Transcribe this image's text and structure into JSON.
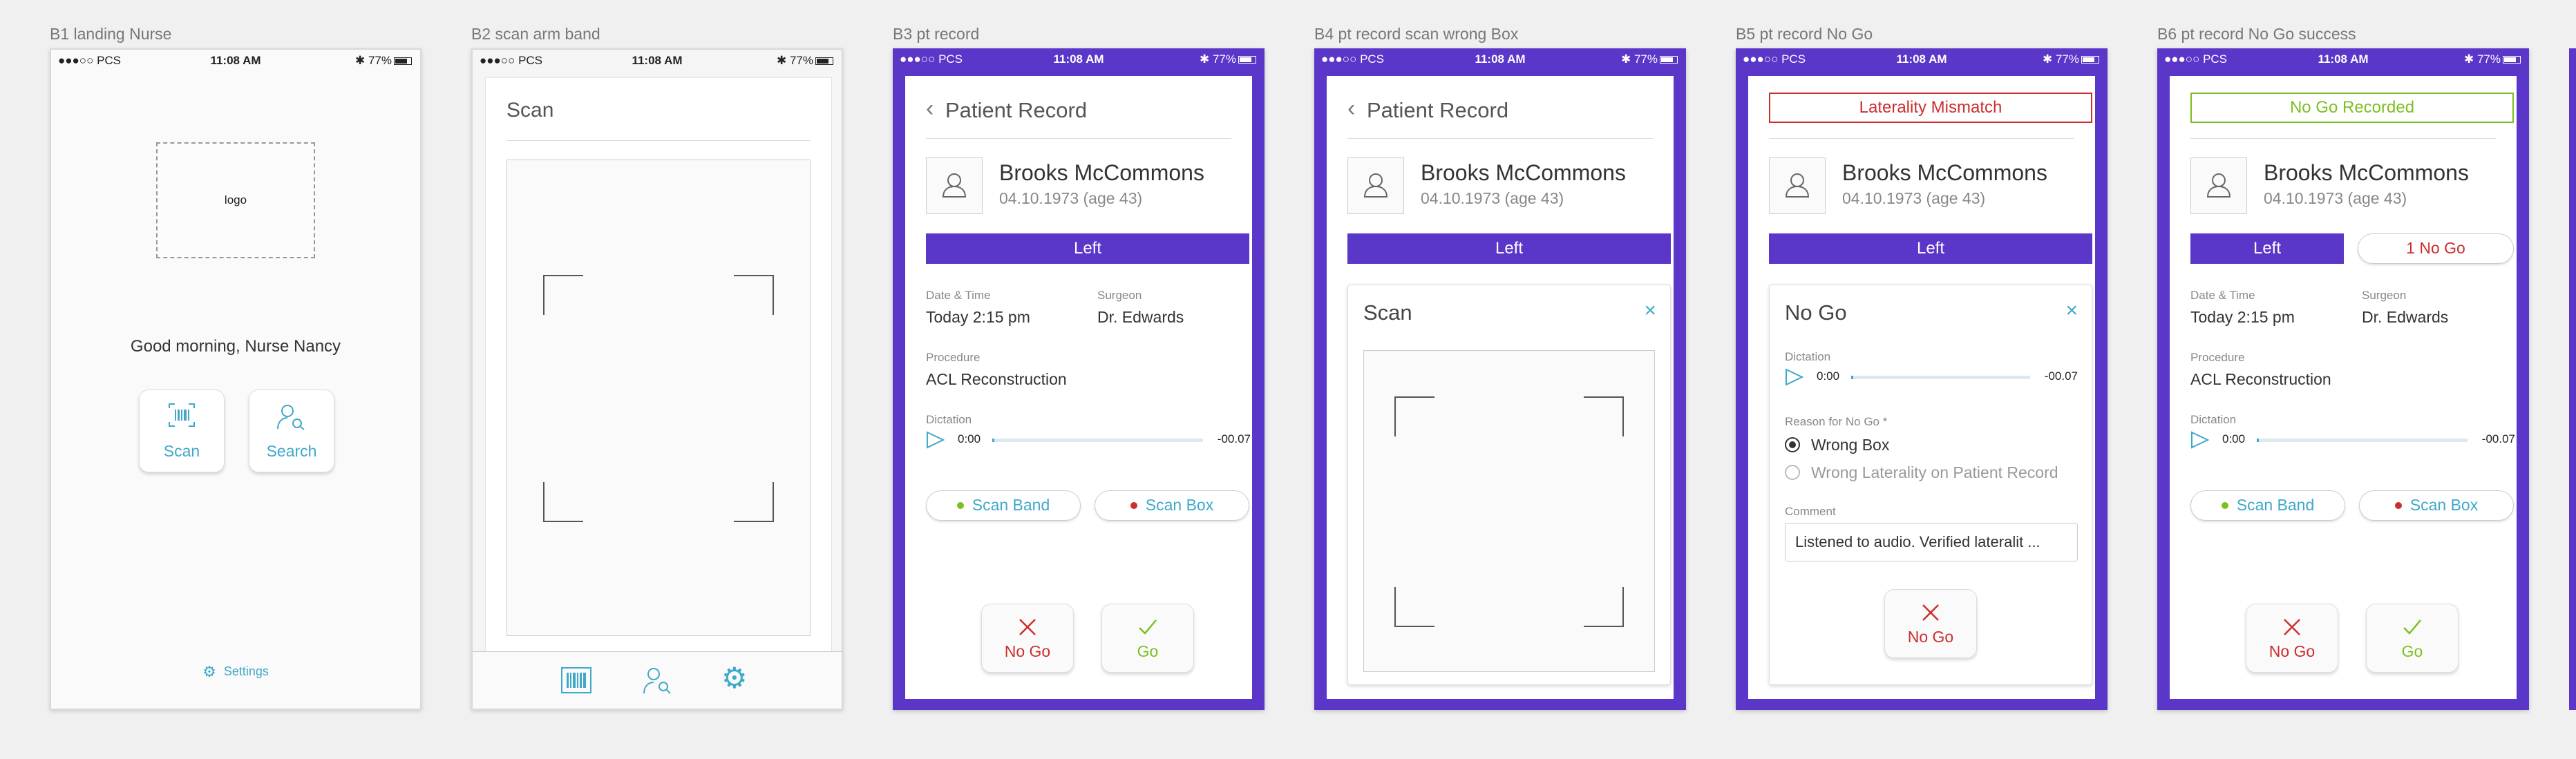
{
  "status": {
    "carrier": "●●●○○ PCS",
    "time": "11:08 AM",
    "battery": "77%"
  },
  "colors": {
    "purple": "#5a36c9",
    "teal": "#3fa9c9",
    "red": "#cc2e2e",
    "green": "#7cbf22"
  },
  "screens": {
    "b1": {
      "label": "B1 landing Nurse",
      "logo": "logo",
      "greeting": "Good morning, Nurse Nancy",
      "scan": "Scan",
      "search": "Search",
      "settings": "Settings"
    },
    "b2": {
      "label": "B2 scan arm band",
      "title": "Scan"
    },
    "b3": {
      "label": "B3 pt record",
      "title": "Patient Record",
      "patient_name": "Brooks McCommons",
      "dob": "04.10.1973 (age 43)",
      "laterality": "Left",
      "datetime_label": "Date & Time",
      "datetime": "Today 2:15 pm",
      "surgeon_label": "Surgeon",
      "surgeon": "Dr. Edwards",
      "procedure_label": "Procedure",
      "procedure": "ACL Reconstruction",
      "dictation_label": "Dictation",
      "time_start": "0:00",
      "time_end": "-00.07",
      "scan_band": "Scan Band",
      "scan_box": "Scan Box",
      "nogo": "No Go",
      "go": "Go"
    },
    "b4": {
      "label": "B4 pt record scan wrong Box",
      "title": "Patient Record",
      "patient_name": "Brooks McCommons",
      "dob": "04.10.1973 (age 43)",
      "laterality": "Left",
      "modal_title": "Scan"
    },
    "b5": {
      "label": "B5 pt record No Go",
      "banner": "Laterality Mismatch",
      "patient_name": "Brooks McCommons",
      "dob": "04.10.1973 (age 43)",
      "laterality": "Left",
      "modal_title": "No Go",
      "dictation_label": "Dictation",
      "time_start": "0:00",
      "time_end": "-00.07",
      "reason_label": "Reason for No Go *",
      "reasons": [
        "Wrong Box",
        "Wrong Laterality on Patient Record"
      ],
      "comment_label": "Comment",
      "comment_value": "Listened to audio. Verified lateralit ...",
      "nogo": "No Go"
    },
    "b6": {
      "label": "B6 pt record No Go success",
      "banner": "No Go Recorded",
      "patient_name": "Brooks McCommons",
      "dob": "04.10.1973 (age 43)",
      "laterality": "Left",
      "nogo_count": "1 No Go",
      "datetime_label": "Date & Time",
      "datetime": "Today 2:15 pm",
      "surgeon_label": "Surgeon",
      "surgeon": "Dr. Edwards",
      "procedure_label": "Procedure",
      "procedure": "ACL Reconstruction",
      "dictation_label": "Dictation",
      "time_start": "0:00",
      "time_end": "-00.07",
      "scan_band": "Scan Band",
      "scan_box": "Scan Box",
      "nogo": "No Go",
      "go": "Go"
    }
  }
}
